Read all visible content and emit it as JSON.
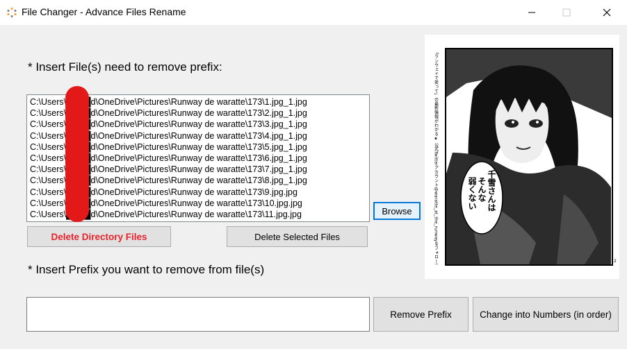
{
  "window": {
    "title": "File Changer - Advance Files Rename",
    "minimize_glyph": "—",
    "maximize_glyph": "☐",
    "close_glyph": "✕"
  },
  "files_section": {
    "label": "* Insert File(s) need to remove prefix:",
    "items": [
      "C:\\Users\\████d\\OneDrive\\Pictures\\Runway de waratte\\173\\1.jpg_1.jpg",
      "C:\\Users\\████d\\OneDrive\\Pictures\\Runway de waratte\\173\\2.jpg_1.jpg",
      "C:\\Users\\████d\\OneDrive\\Pictures\\Runway de waratte\\173\\3.jpg_1.jpg",
      "C:\\Users\\████d\\OneDrive\\Pictures\\Runway de waratte\\173\\4.jpg_1.jpg",
      "C:\\Users\\████d\\OneDrive\\Pictures\\Runway de waratte\\173\\5.jpg_1.jpg",
      "C:\\Users\\████d\\OneDrive\\Pictures\\Runway de waratte\\173\\6.jpg_1.jpg",
      "C:\\Users\\████d\\OneDrive\\Pictures\\Runway de waratte\\173\\7.jpg_1.jpg",
      "C:\\Users\\████d\\OneDrive\\Pictures\\Runway de waratte\\173\\8.jpg_1.jpg",
      "C:\\Users\\████d\\OneDrive\\Pictures\\Runway de waratte\\173\\9.jpg.jpg",
      "C:\\Users\\████d\\OneDrive\\Pictures\\Runway de waratte\\173\\10.jpg.jpg",
      "C:\\Users\\████d\\OneDrive\\Pictures\\Runway de waratte\\173\\11.jpg.jpg"
    ]
  },
  "buttons": {
    "browse": "Browse",
    "delete_directory": "Delete Directory Files",
    "delete_selected": "Delete Selected Files",
    "remove_prefix": "Remove Prefix",
    "change_numbers": "Change into Numbers (in order)"
  },
  "prefix_section": {
    "label": "* Insert Prefix you want to remove from file(s)",
    "value": ""
  },
  "preview": {
    "speech_bubble": [
      "千雪さんは",
      "そんな",
      "弱くない"
    ],
    "side_text": "「ランウェイで笑って」の最新情報がわかる★ 公式Twitterアカウント@waratte_at_the_runwayをフォロー!",
    "page_number": "2"
  },
  "colors": {
    "delete_label": "#e8232a",
    "redaction": "#e31818",
    "focus_border": "#0078d7"
  }
}
